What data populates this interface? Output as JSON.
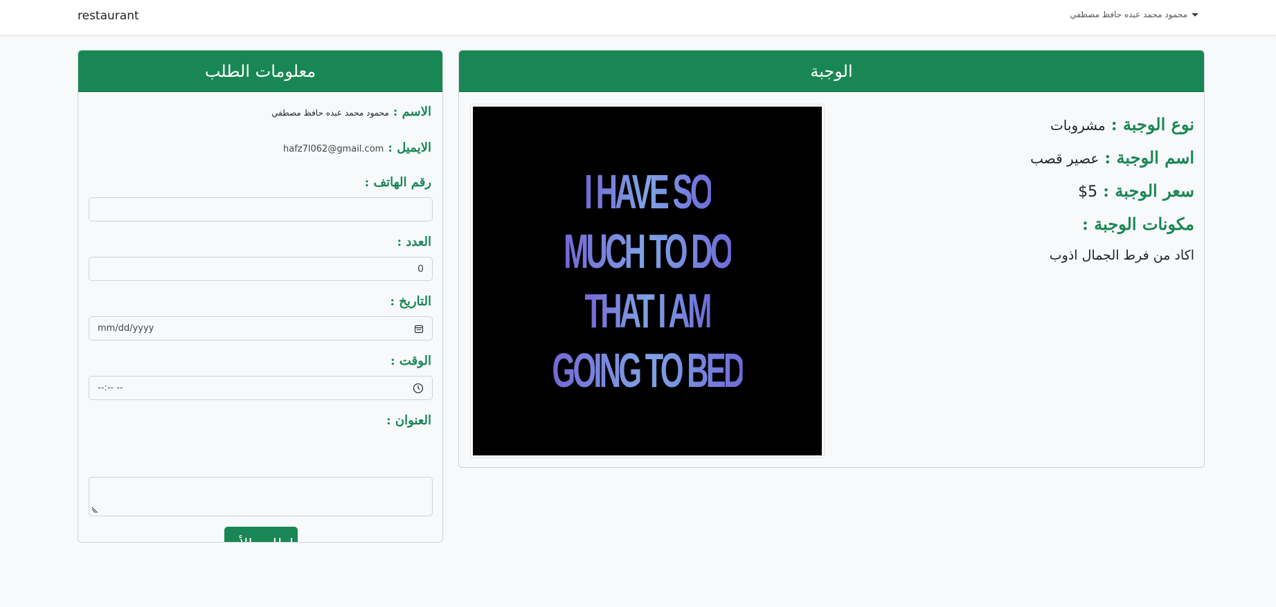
{
  "navbar": {
    "brand": "restaurant",
    "user_name": "محمود محمد عبده حافظ مصطفي"
  },
  "order_card": {
    "title": "معلومات الطلب",
    "name_label": "الاسم :",
    "name_value": "محمود محمد عبده حافظ مصطفي",
    "email_label": "الايميل :",
    "email_value": "hafz7l062@gmail.com",
    "phone_label": "رقم الهاتف :",
    "phone_value": "",
    "quantity_label": "العدد :",
    "quantity_value": "0",
    "date_label": "التاريخ :",
    "date_placeholder": "mm/dd/yyyy",
    "time_label": "الوقت :",
    "time_placeholder": "--:-- --",
    "address_label": "العنوان :",
    "address_value": "",
    "submit_label": "اطلب الأن"
  },
  "meal_card": {
    "title": "الوجبة",
    "type_label": "نوع الوجبة :",
    "type_value": "مشروبات",
    "name_label": "اسم الوجبة :",
    "name_value": "عصير قصب",
    "price_label": "سعر الوجبة :",
    "price_value": "$5",
    "ingredients_label": "مكونات الوجبة :",
    "ingredients_value": "اكاد من فرط الجمال اذوب",
    "image_text": [
      "I HAVE SO",
      "MUCH TO DO",
      "THAT I AM",
      "GOING TO BED"
    ]
  },
  "colors": {
    "accent": "#198754",
    "background": "#f7f9fb",
    "border": "#ced4da"
  },
  "icons": {
    "user_dropdown": "caret-down-icon",
    "date_input": "calendar-icon",
    "time_input": "clock-icon",
    "textarea": "resize-handle-icon"
  }
}
